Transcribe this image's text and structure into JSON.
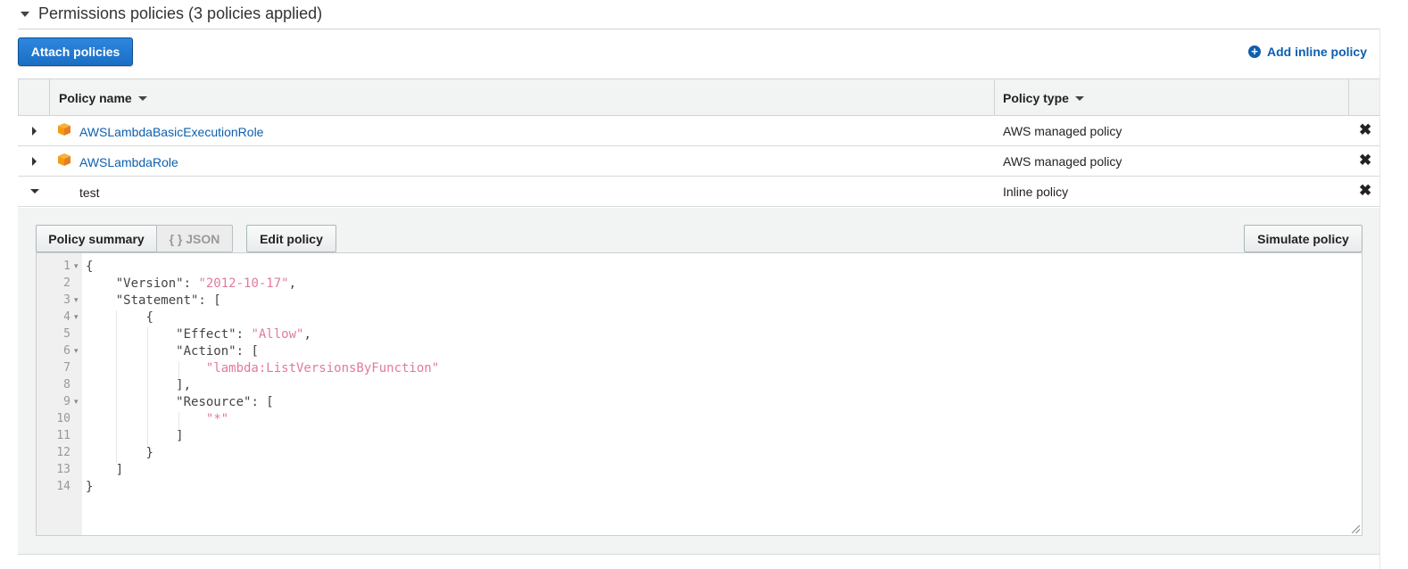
{
  "section": {
    "title": "Permissions policies (3 policies applied)"
  },
  "actions": {
    "attach_label": "Attach policies",
    "add_inline_label": "Add inline policy",
    "add_inline_icon": "plus-circle-icon"
  },
  "table": {
    "headers": {
      "name": "Policy name",
      "type": "Policy type"
    },
    "rows": [
      {
        "name": "AWSLambdaBasicExecutionRole",
        "type": "AWS managed policy",
        "icon": "aws-cube-icon",
        "expanded": false
      },
      {
        "name": "AWSLambdaRole",
        "type": "AWS managed policy",
        "icon": "aws-cube-icon",
        "expanded": false
      },
      {
        "name": "test",
        "type": "Inline policy",
        "icon": "",
        "expanded": true
      }
    ],
    "remove_glyph": "✖"
  },
  "detail": {
    "tabs": {
      "summary": "Policy summary",
      "json": "{ } JSON"
    },
    "edit_label": "Edit policy",
    "simulate_label": "Simulate policy",
    "code_lines": [
      {
        "n": "1",
        "text": "{"
      },
      {
        "n": "2",
        "key": "\"Version\"",
        "value": "\"2012-10-17\""
      },
      {
        "n": "3",
        "text": "\"Statement\": ["
      },
      {
        "n": "4",
        "text": "{"
      },
      {
        "n": "5",
        "key": "\"Effect\"",
        "value": "\"Allow\""
      },
      {
        "n": "6",
        "text": "\"Action\": ["
      },
      {
        "n": "7",
        "value": "\"lambda:ListVersionsByFunction\""
      },
      {
        "n": "8",
        "text": "],"
      },
      {
        "n": "9",
        "text": "\"Resource\": ["
      },
      {
        "n": "10",
        "value": "\"*\""
      },
      {
        "n": "11",
        "text": "]"
      },
      {
        "n": "12",
        "text": "}"
      },
      {
        "n": "13",
        "text": "]"
      },
      {
        "n": "14",
        "text": "}"
      }
    ]
  },
  "colors": {
    "primary": "#1a6fc4",
    "link": "#0e5fad",
    "string": "#e07aa1",
    "aws_orange": "#f39c12"
  }
}
